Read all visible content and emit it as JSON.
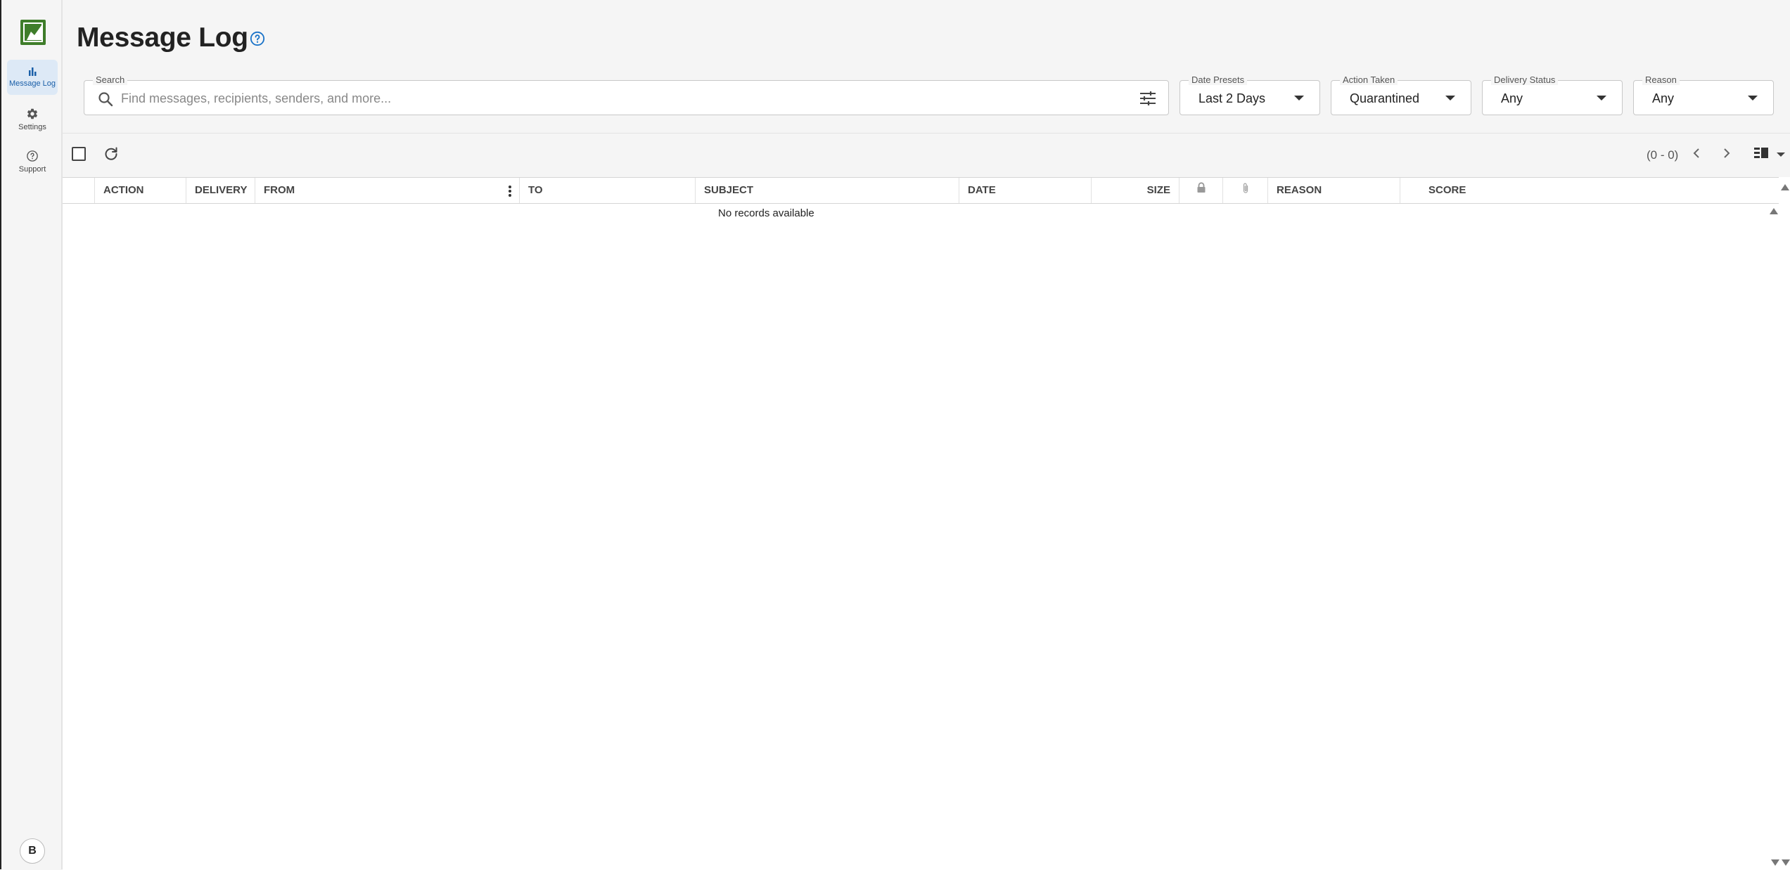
{
  "nav": {
    "items": [
      {
        "label": "Message Log",
        "icon": "bar-chart-icon",
        "active": true
      },
      {
        "label": "Settings",
        "icon": "gear-icon",
        "active": false
      },
      {
        "label": "Support",
        "icon": "help-circle-icon",
        "active": false
      }
    ],
    "avatar_initial": "B"
  },
  "header": {
    "title": "Message Log"
  },
  "search": {
    "label": "Search",
    "placeholder": "Find messages, recipients, senders, and more..."
  },
  "filters": {
    "date_presets": {
      "label": "Date Presets",
      "value": "Last 2 Days"
    },
    "action_taken": {
      "label": "Action Taken",
      "value": "Quarantined"
    },
    "delivery_status": {
      "label": "Delivery Status",
      "value": "Any"
    },
    "reason": {
      "label": "Reason",
      "value": "Any"
    }
  },
  "pager": {
    "range": "(0 - 0)"
  },
  "table": {
    "columns": [
      "ACTION",
      "DELIVERY",
      "FROM",
      "TO",
      "SUBJECT",
      "DATE",
      "SIZE",
      "",
      "",
      "REASON",
      "SCORE"
    ],
    "empty_message": "No records available"
  },
  "colors": {
    "accent": "#1a5fa8",
    "brand": "#3f7d2a"
  }
}
